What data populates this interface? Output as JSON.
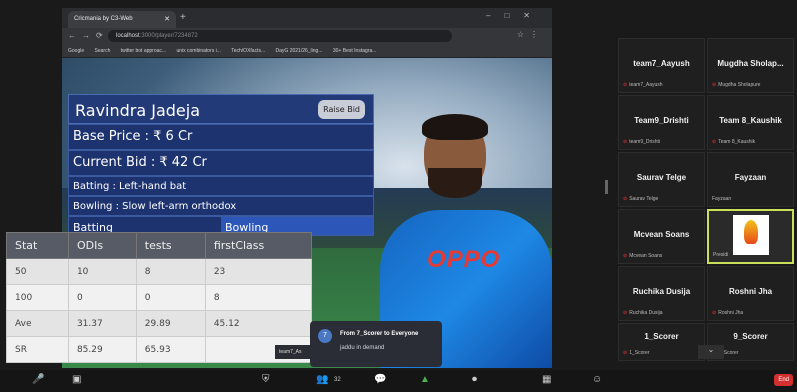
{
  "browser": {
    "tab_title": "Cricmania by C3-Web",
    "url_host": "localhost",
    "url_path": ":3000/player/7234872",
    "bookmarks": [
      "Google",
      "Search",
      "twitter bot approac...",
      "unix combinators i...",
      "Tech/OXfacts...",
      "DayG 2021/26_ling...",
      "30+ Best Instagra..."
    ]
  },
  "player": {
    "name": "Ravindra Jadeja",
    "raise_bid_label": "Raise Bid",
    "base_price": "Base Price : ₹ 6 Cr",
    "current_bid": "Current Bid : ₹ 42 Cr",
    "batting": "Batting : Left-hand bat",
    "bowling": "Bowling : Slow left-arm orthodox",
    "tabs": [
      "Batting",
      "Bowling"
    ],
    "jersey_text": "OPPO"
  },
  "stats": {
    "headers": [
      "Stat",
      "ODIs",
      "tests",
      "firstClass"
    ],
    "rows": [
      [
        "50",
        "10",
        "8",
        "23"
      ],
      [
        "100",
        "0",
        "0",
        "8"
      ],
      [
        "Ave",
        "31.37",
        "29.89",
        "45.12"
      ],
      [
        "SR",
        "85.29",
        "65.93",
        ""
      ]
    ]
  },
  "chat": {
    "avatar": "7",
    "from": "From 7_Scorer to Everyone",
    "message": "jaddu in demand",
    "chip": "team7_As"
  },
  "participants": [
    {
      "name": "team7_Aayush",
      "sub": "team7_Aayush"
    },
    {
      "name": "Mugdha Sholap...",
      "sub": "Mugdha Sholapure"
    },
    {
      "name": "Team9_Drishti",
      "sub": "team9_Drishti"
    },
    {
      "name": "Team 8_Kaushik",
      "sub": "Team 8_Kaushik"
    },
    {
      "name": "Saurav Telge",
      "sub": "Saurav Telge"
    },
    {
      "name": "Fayzaan",
      "sub": "Fayzaan"
    },
    {
      "name": "Mcvean Soans",
      "sub": "Mcvean Soans"
    },
    {
      "name": "",
      "sub": "Presidi"
    },
    {
      "name": "Ruchika Dusija",
      "sub": "Ruchika Dusija"
    },
    {
      "name": "Roshni Jha",
      "sub": "Roshni Jha"
    },
    {
      "name": "1_Scorer",
      "sub": "1_Scorer"
    },
    {
      "name": "9_Scorer",
      "sub": "1_Scorer"
    }
  ],
  "meeting": {
    "participant_count": "32",
    "end_label": "End"
  },
  "colors": {
    "accent": "#c8e05a",
    "panel": "#233a78",
    "end": "#d32f2f"
  }
}
